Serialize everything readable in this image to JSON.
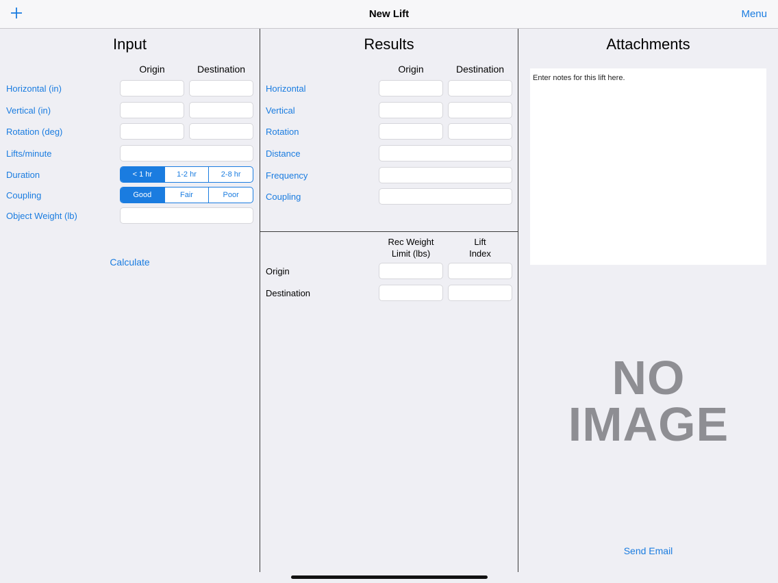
{
  "navbar": {
    "title": "New Lift",
    "menu_label": "Menu",
    "add_icon": "plus-icon"
  },
  "input": {
    "title": "Input",
    "col_origin": "Origin",
    "col_destination": "Destination",
    "horizontal_label": "Horizontal (in)",
    "vertical_label": "Vertical (in)",
    "rotation_label": "Rotation (deg)",
    "lifts_label": "Lifts/minute",
    "duration_label": "Duration",
    "duration_options": [
      "< 1 hr",
      "1-2 hr",
      "2-8 hr"
    ],
    "duration_selected": "< 1 hr",
    "coupling_label": "Coupling",
    "coupling_options": [
      "Good",
      "Fair",
      "Poor"
    ],
    "coupling_selected": "Good",
    "weight_label": "Object Weight (lb)",
    "calculate_label": "Calculate"
  },
  "results": {
    "title": "Results",
    "col_origin": "Origin",
    "col_destination": "Destination",
    "horizontal_label": "Horizontal",
    "vertical_label": "Vertical",
    "rotation_label": "Rotation",
    "distance_label": "Distance",
    "frequency_label": "Frequency",
    "coupling_label": "Coupling",
    "rwl_header_line1": "Rec Weight",
    "rwl_header_line2": "Limit (lbs)",
    "li_header_line1": "Lift",
    "li_header_line2": "Index",
    "origin_label": "Origin",
    "destination_label": "Destination"
  },
  "attachments": {
    "title": "Attachments",
    "notes_placeholder": "Enter notes for this lift here.",
    "no_image_line1": "NO",
    "no_image_line2": "IMAGE",
    "send_email_label": "Send Email"
  },
  "colors": {
    "accent": "#1a7ce0",
    "background": "#efeff4",
    "placeholder_gray": "#8e8e93"
  }
}
